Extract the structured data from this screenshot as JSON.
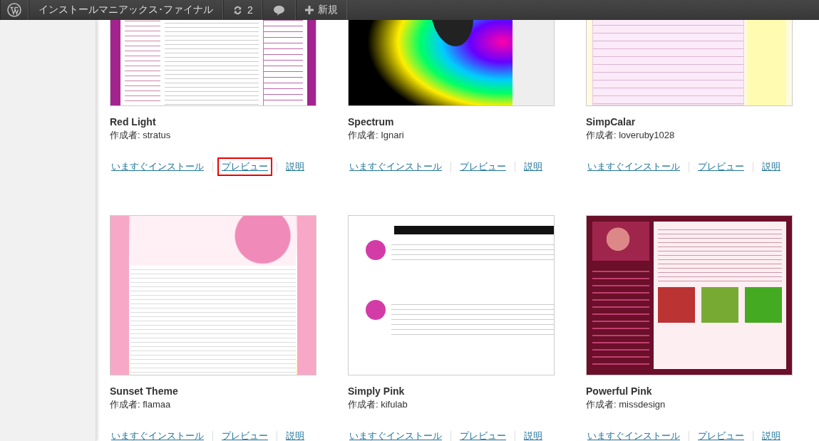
{
  "admin_bar": {
    "site_title": "インストールマニアックス･ファイナル",
    "updates_count": "2",
    "new_label": "新規"
  },
  "themes": [
    {
      "kind": "red-light",
      "name": "Red Light",
      "author": "作成者: stratus",
      "links": [
        {
          "label": "いますぐインストール",
          "highlighted": false
        },
        {
          "label": "プレビュー",
          "highlighted": true
        },
        {
          "label": "説明",
          "highlighted": false
        }
      ]
    },
    {
      "kind": "spectrum",
      "name": "Spectrum",
      "author": "作成者: Ignari",
      "links": [
        {
          "label": "いますぐインストール",
          "highlighted": false
        },
        {
          "label": "プレビュー",
          "highlighted": false
        },
        {
          "label": "説明",
          "highlighted": false
        }
      ]
    },
    {
      "kind": "simpcalar",
      "name": "SimpCalar",
      "author": "作成者: loveruby1028",
      "links": [
        {
          "label": "いますぐインストール",
          "highlighted": false
        },
        {
          "label": "プレビュー",
          "highlighted": false
        },
        {
          "label": "説明",
          "highlighted": false
        }
      ]
    },
    {
      "kind": "sunset",
      "name": "Sunset Theme",
      "author": "作成者: flamaa",
      "links": [
        {
          "label": "いますぐインストール",
          "highlighted": false
        },
        {
          "label": "プレビュー",
          "highlighted": false
        },
        {
          "label": "説明",
          "highlighted": false
        }
      ]
    },
    {
      "kind": "simply-pink",
      "name": "Simply Pink",
      "author": "作成者: kifulab",
      "links": [
        {
          "label": "いますぐインストール",
          "highlighted": false
        },
        {
          "label": "プレビュー",
          "highlighted": false
        },
        {
          "label": "説明",
          "highlighted": false
        }
      ]
    },
    {
      "kind": "powerful-pink",
      "name": "Powerful Pink",
      "author": "作成者: missdesign",
      "links": [
        {
          "label": "いますぐインストール",
          "highlighted": false
        },
        {
          "label": "プレビュー",
          "highlighted": false
        },
        {
          "label": "説明",
          "highlighted": false
        }
      ]
    }
  ]
}
